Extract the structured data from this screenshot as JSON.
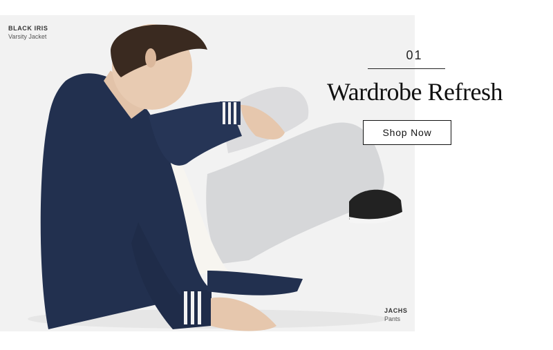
{
  "hero": {
    "tag_top": {
      "brand": "BLACK IRIS",
      "item": "Varsity Jacket"
    },
    "tag_bottom": {
      "brand": "JACHS",
      "item": "Pants"
    }
  },
  "promo": {
    "number": "01",
    "title": "Wardrobe Refresh",
    "cta_label": "Shop Now"
  },
  "colors": {
    "photo_background": "#f2f2f2",
    "jacket_navy": "#22304f",
    "pants_gray": "#d6d7d9",
    "text_dark": "#111111"
  }
}
